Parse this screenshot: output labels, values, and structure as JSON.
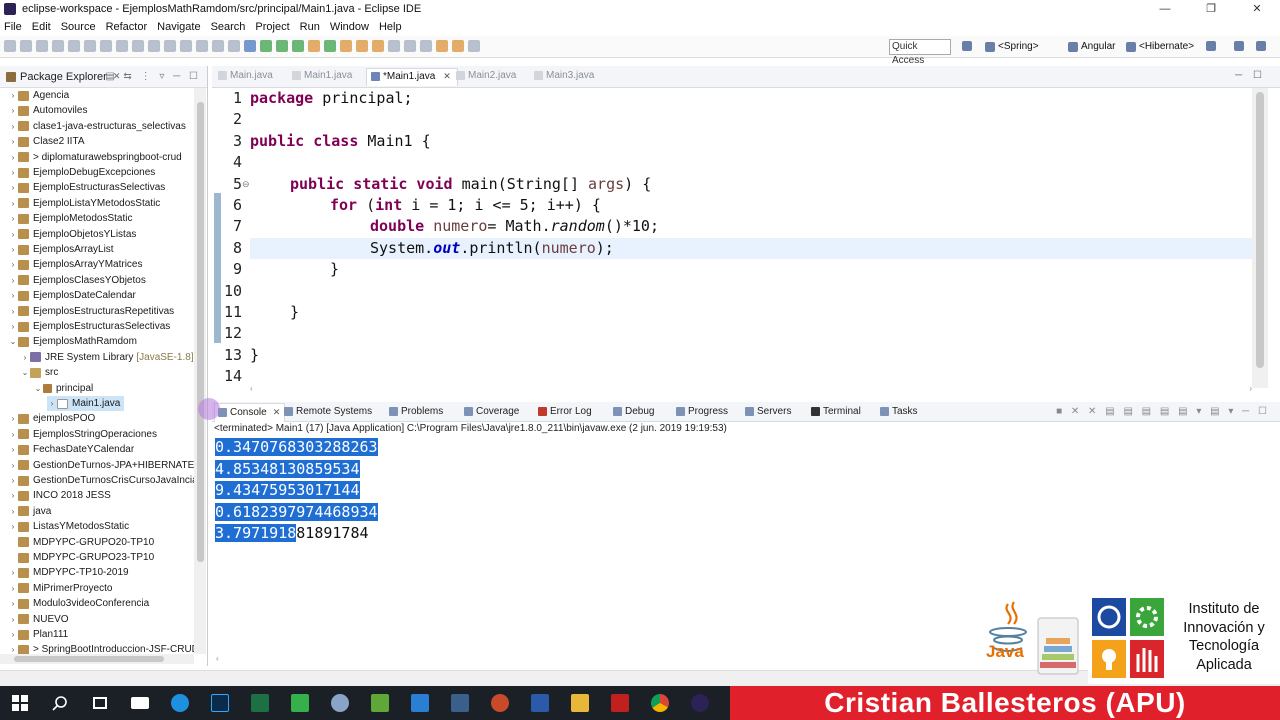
{
  "window": {
    "title": "eclipse-workspace - EjemplosMathRamdom/src/principal/Main1.java - Eclipse IDE",
    "controls": [
      "—",
      "❐",
      "✕"
    ]
  },
  "menu": [
    "File",
    "Edit",
    "Source",
    "Refactor",
    "Navigate",
    "Search",
    "Project",
    "Run",
    "Window",
    "Help"
  ],
  "toolbar": {
    "quick_access": "Quick Access",
    "perspectives": [
      "<Spring>",
      "Angular",
      "<Hibernate>"
    ]
  },
  "package_explorer": {
    "title": "Package Explorer",
    "items": [
      "Agencia",
      "Automoviles",
      "clase1-java-estructuras_selectivas",
      "Clase2 IITA",
      "> diplomaturawebspringboot-crud",
      "EjemploDebugExcepciones",
      "EjemploEstructurasSelectivas",
      "EjemploListaYMetodosStatic",
      "EjemploMetodosStatic",
      "EjemploObjetosYListas",
      "EjemplosArrayList",
      "EjemplosArrayYMatrices",
      "EjemplosClasesYObjetos",
      "EjemplosDateCalendar",
      "EjemplosEstructurasRepetitivas",
      "EjemplosEstructurasSelectivas",
      "EjemplosMathRamdom",
      "JRE System Library",
      "src",
      "principal",
      "Main1.java",
      "ejemplosPOO",
      "EjemplosStringOperaciones",
      "FechasDateYCalendar",
      "GestionDeTurnos-JPA+HIBERNATE",
      "GestionDeTurnosCrisCursoJavaIncia",
      "INCO 2018 JESS",
      "java",
      "ListasYMetodosStatic",
      "MDPYPC-GRUPO20-TP10",
      "MDPYPC-GRUPO23-TP10",
      "MDPYPC-TP10-2019",
      "MiPrimerProyecto",
      "Modulo3videoConferencia",
      "NUEVO",
      "Plan111",
      "> SpringBootIntroduccion-JSF-CRUD"
    ],
    "jre_suffix": "[JavaSE-1.8]"
  },
  "editor": {
    "tabs": [
      "Main.java",
      "Main1.java",
      "*Main1.java",
      "Main2.java",
      "Main3.java"
    ],
    "active_tab_index": 2,
    "line_numbers": [
      "1",
      "2",
      "3",
      "4",
      "5",
      "6",
      "7",
      "8",
      "9",
      "10",
      "11",
      "12",
      "13",
      "14"
    ],
    "code": {
      "l1_kw": "package",
      "l1_rest": " principal;",
      "l3_kw1": "public",
      "l3_kw2": "class",
      "l3_rest": " Main1 {",
      "l5_kw": "public static void",
      "l5_mid": " main(String[] ",
      "l5_var": "args",
      "l5_end": ") {",
      "l6_kw": "for",
      "l6_a": " (",
      "l6_kw2": "int",
      "l6_b": " i = 1; i <= 5; i++) {",
      "l7_kw": "double",
      "l7_var": "numero",
      "l7_a": "= Math.",
      "l7_it": "random",
      "l7_b": "()*10;",
      "l8_a": "System.",
      "l8_fld": "out",
      "l8_b": ".println(",
      "l8_var": "numero",
      "l8_c": ");",
      "l9": "}",
      "l11": "}",
      "l13": "}"
    }
  },
  "console": {
    "tabs": [
      "Console",
      "Remote Systems",
      "Problems",
      "Coverage",
      "Error Log",
      "Debug",
      "Progress",
      "Servers",
      "Terminal",
      "Tasks"
    ],
    "terminated": "<terminated> Main1 (17) [Java Application] C:\\Program Files\\Java\\jre1.8.0_211\\bin\\javaw.exe (2 jun. 2019 19:19:53)",
    "output": [
      "0.3470768303288263",
      "4.85348130859534",
      "9.43475953017144",
      "0.6182397974468934",
      "3.79719181891784"
    ],
    "last_selected_part": "3.7971918",
    "last_unselected_part": "81891784"
  },
  "overlay": {
    "presenter": "Cristian Ballesteros (APU)",
    "java_logo": "Java",
    "institute": [
      "Instituto de",
      "Innovación y",
      "Tecnología",
      "Aplicada"
    ]
  },
  "colors": {
    "keyword": "#7f0055",
    "selection": "#1f6ed4",
    "banner": "#e0202a"
  }
}
